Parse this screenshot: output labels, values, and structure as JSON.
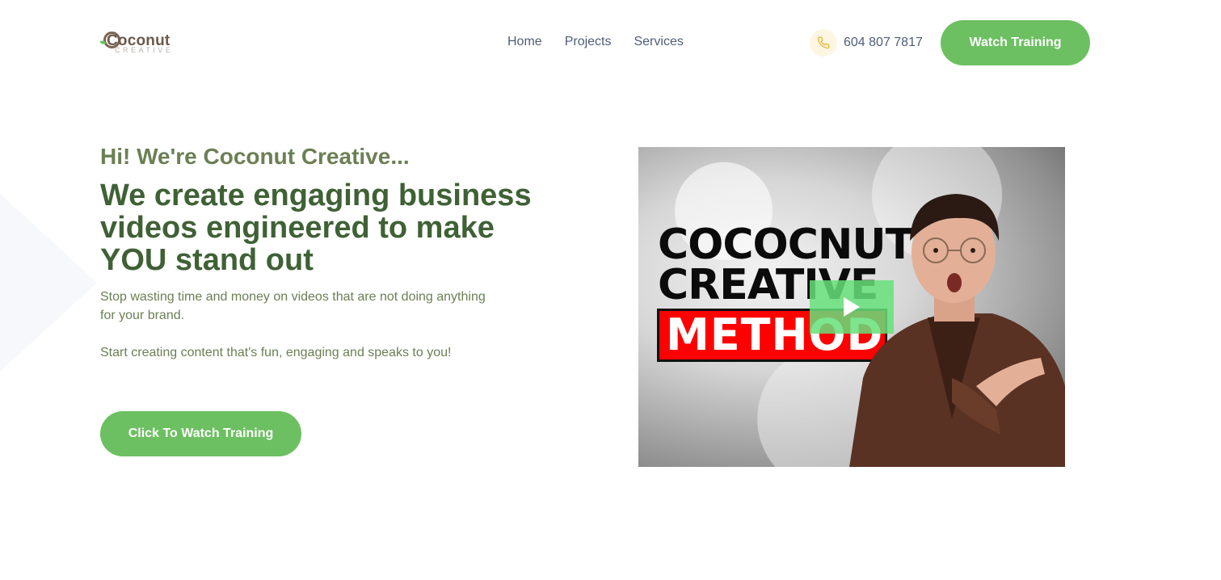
{
  "brand": {
    "name": "Coconut",
    "sub": "CREATIVE"
  },
  "nav": {
    "items": [
      {
        "label": "Home"
      },
      {
        "label": "Projects"
      },
      {
        "label": "Services"
      }
    ]
  },
  "contact": {
    "phone": "604 807 7817"
  },
  "header": {
    "cta_label": "Watch Training"
  },
  "hero": {
    "greeting": "Hi! We're Coconut Creative...",
    "headline": "We create engaging business videos engineered to make YOU stand out",
    "paragraph1": "Stop wasting time and money on videos that are not doing anything for your brand.",
    "paragraph2": "Start creating content that's fun, engaging and speaks to you!",
    "cta_label": "Click To Watch Training"
  },
  "video": {
    "title_line1": "COCOCNUT",
    "title_line2": "CREATIVE",
    "title_line3": "METHOD"
  },
  "colors": {
    "accent": "#6cc061",
    "headline": "#3f6135",
    "body": "#6b7f54",
    "nav": "#4e5d78"
  }
}
